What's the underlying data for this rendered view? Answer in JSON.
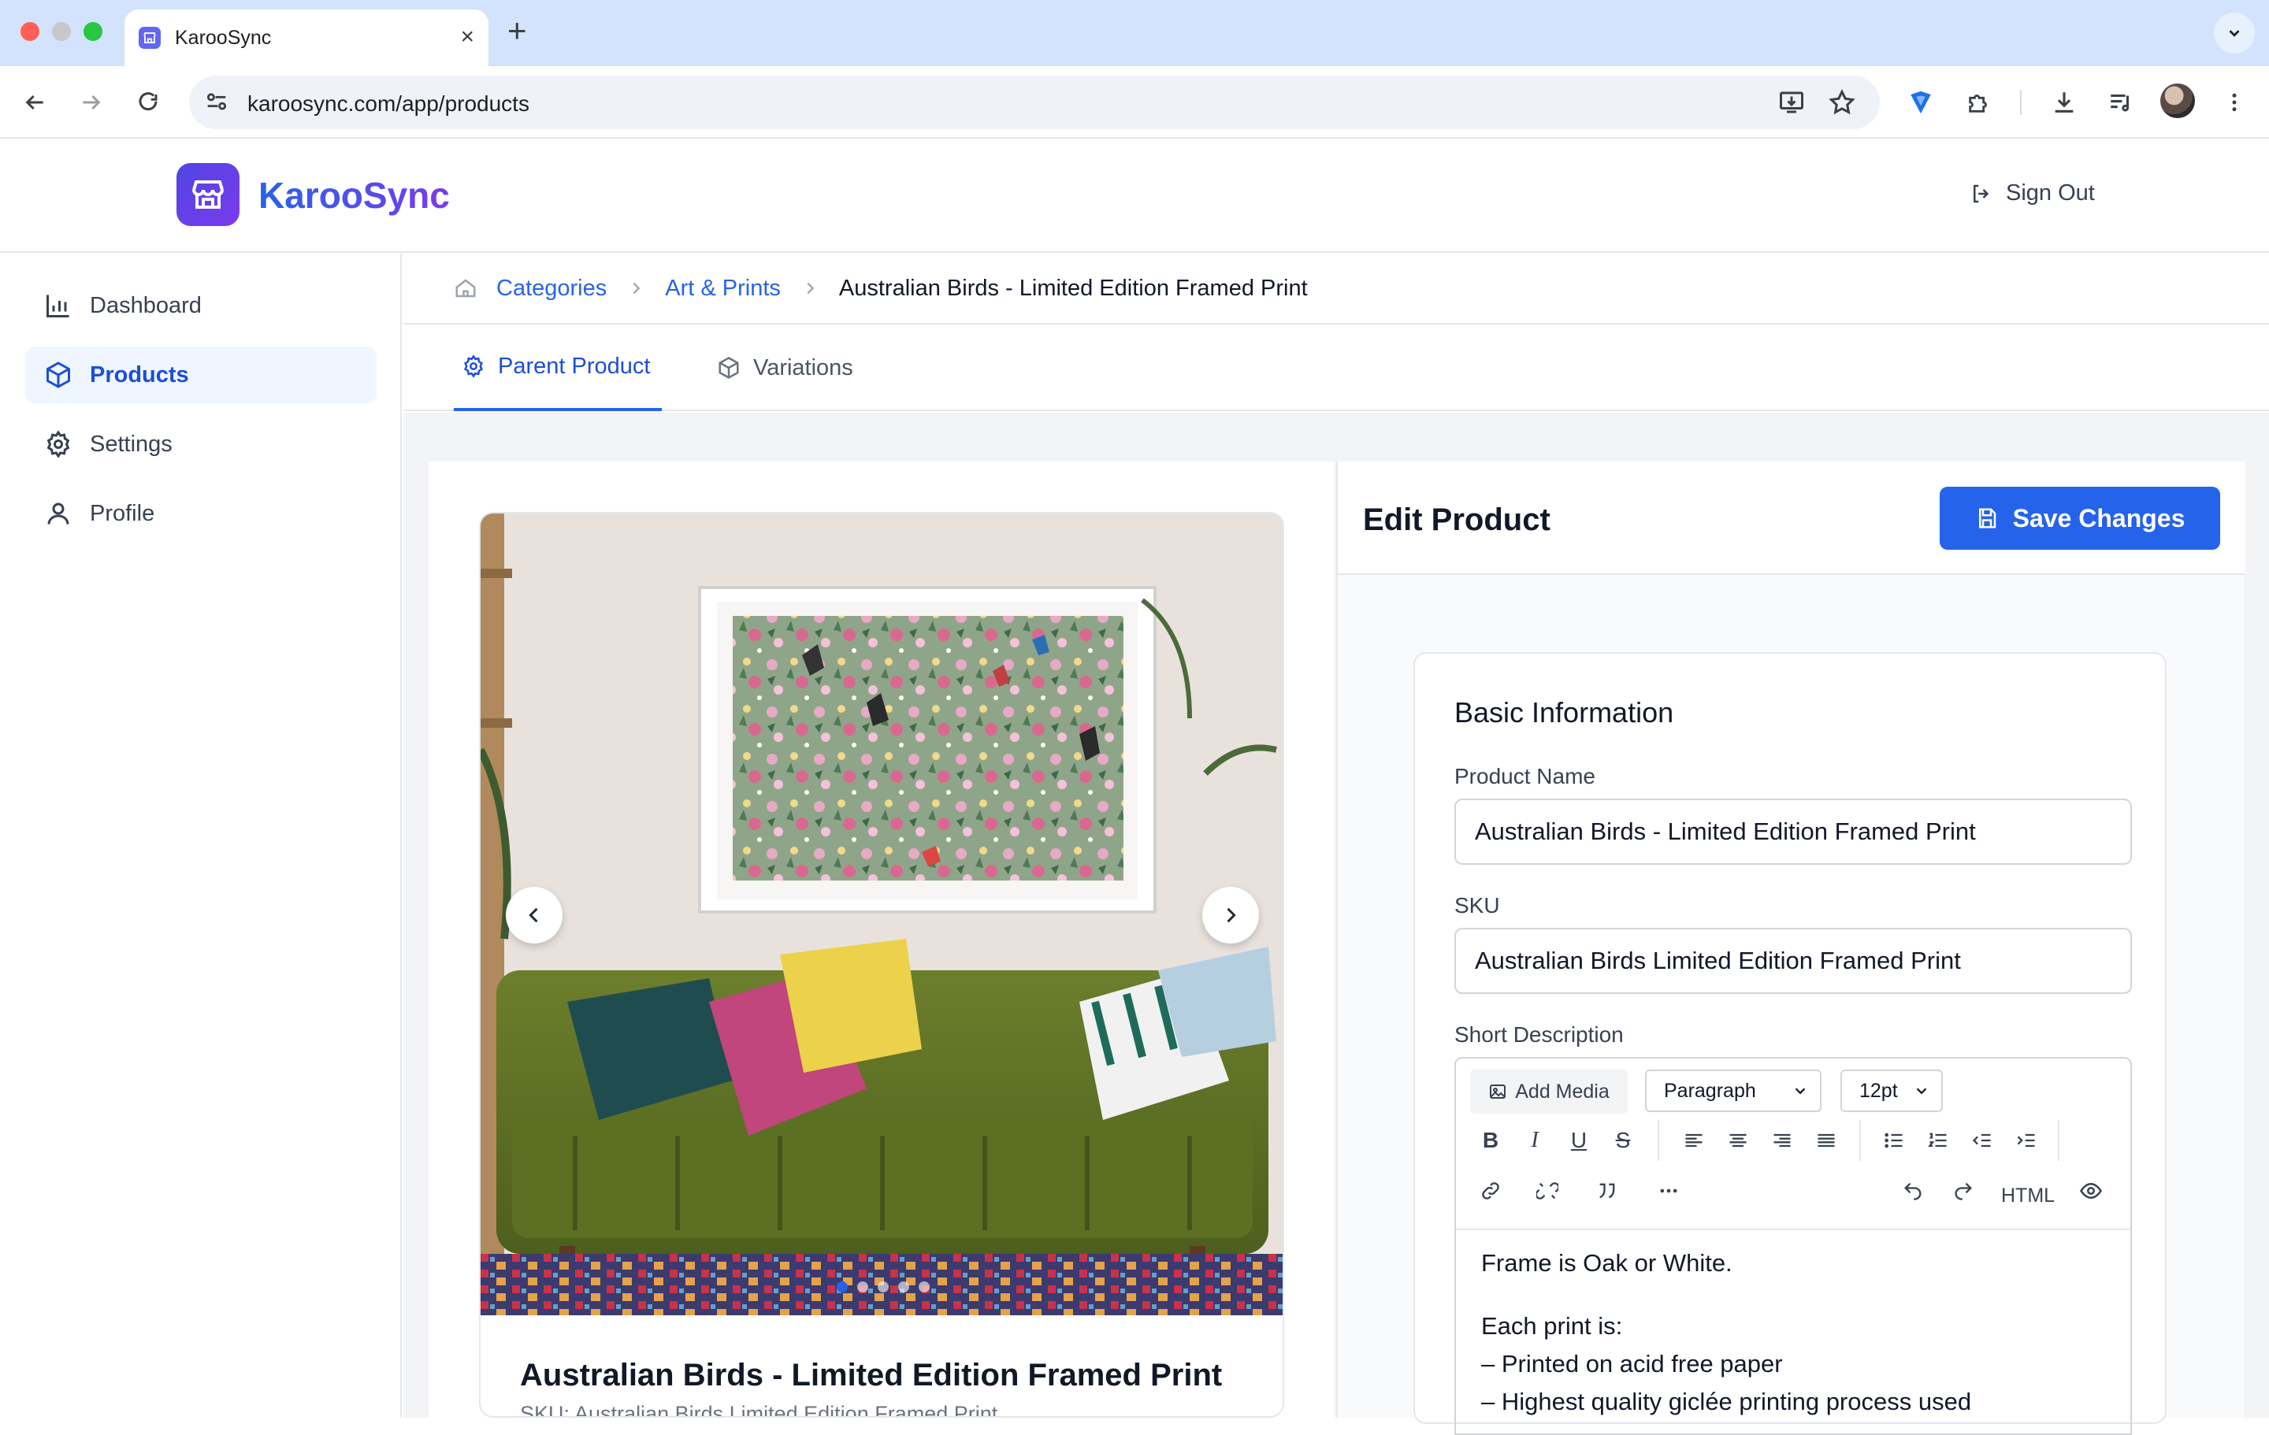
{
  "browser": {
    "tab_title": "KarooSync",
    "url": "karoosync.com/app/products"
  },
  "app": {
    "name": "KarooSync",
    "sign_out": "Sign Out"
  },
  "sidebar": {
    "items": [
      {
        "label": "Dashboard",
        "icon": "bar-chart-icon"
      },
      {
        "label": "Products",
        "icon": "cube-icon",
        "active": true
      },
      {
        "label": "Settings",
        "icon": "gear-icon"
      },
      {
        "label": "Profile",
        "icon": "user-icon"
      }
    ]
  },
  "breadcrumb": {
    "items": [
      "Categories",
      "Art & Prints"
    ],
    "current": "Australian Birds - Limited Edition Framed Print"
  },
  "tabs": [
    {
      "label": "Parent Product",
      "active": true
    },
    {
      "label": "Variations"
    }
  ],
  "preview": {
    "title": "Australian Birds - Limited Edition Framed Print",
    "sku_line": "SKU: Australian Birds Limited Edition Framed Print",
    "image_count": 5,
    "active_image": 1
  },
  "edit": {
    "title": "Edit Product",
    "save_label": "Save Changes",
    "section_title": "Basic Information",
    "product_name_label": "Product Name",
    "product_name_value": "Australian Birds - Limited Edition Framed Print",
    "sku_label": "SKU",
    "sku_value": "Australian Birds Limited Edition Framed Print",
    "short_description_label": "Short Description"
  },
  "editor": {
    "add_media": "Add Media",
    "format_value": "Paragraph",
    "size_value": "12pt",
    "html_label": "HTML",
    "body": {
      "line1": "Frame is Oak or White.",
      "line2": "Each print is:",
      "line3": "– Printed on acid free paper",
      "line4": "– Highest quality giclée printing process used"
    }
  },
  "colors": {
    "accent": "#2563eb",
    "brand_gradient_start": "#4f46e5",
    "brand_gradient_end": "#7c3aed"
  }
}
